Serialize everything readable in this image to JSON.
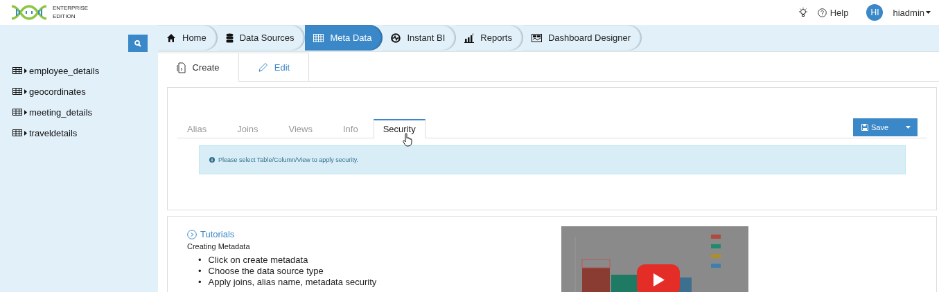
{
  "header": {
    "logo_lines": [
      "ENTERPRISE",
      "EDITION"
    ],
    "help": "Help",
    "avatar": "HI",
    "user": "hiadmin"
  },
  "sidebar": {
    "items": [
      {
        "label": "employee_details"
      },
      {
        "label": "geocordinates"
      },
      {
        "label": "meeting_details"
      },
      {
        "label": "traveldetails"
      }
    ]
  },
  "nav_tabs": [
    {
      "label": "Home",
      "selected": false
    },
    {
      "label": "Data Sources",
      "selected": false
    },
    {
      "label": "Meta Data",
      "selected": true
    },
    {
      "label": "Instant BI",
      "selected": false
    },
    {
      "label": "Reports",
      "selected": false
    },
    {
      "label": "Dashboard Designer",
      "selected": false
    }
  ],
  "mode_tabs": [
    {
      "label": "Create",
      "selected": true
    },
    {
      "label": "Edit",
      "selected": false
    }
  ],
  "sub_tabs": [
    {
      "label": "Alias",
      "selected": false
    },
    {
      "label": "Joins",
      "selected": false
    },
    {
      "label": "Views",
      "selected": false
    },
    {
      "label": "Info",
      "selected": false
    },
    {
      "label": "Security",
      "selected": true
    }
  ],
  "save_button": "Save",
  "info_message": "Please select Table/Column/View to apply security.",
  "tutorials": {
    "title": "Tutorials",
    "subtitle": "Creating Metadata",
    "bullet": "•",
    "steps": [
      "Click on create metadata",
      "Choose the data source type",
      "Apply joins, alias name, metadata security"
    ],
    "video": {
      "kind": "picture"
    }
  }
}
